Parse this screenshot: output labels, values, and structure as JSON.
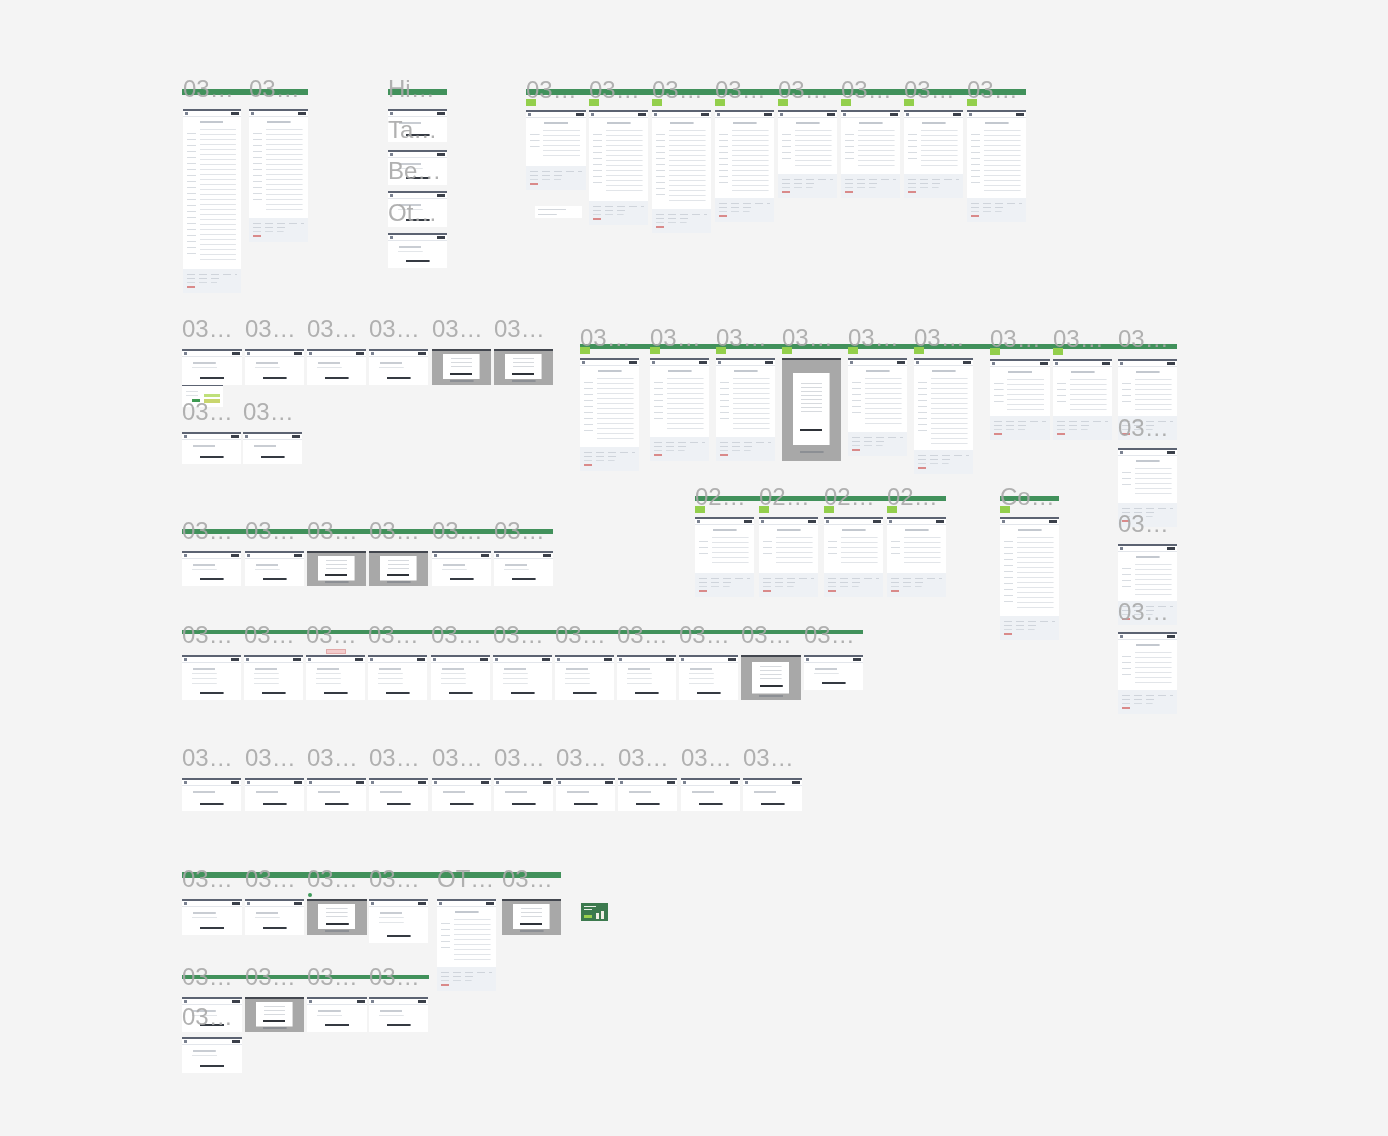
{
  "canvas": {
    "sections": [
      {
        "banner": true,
        "frames": [
          {
            "label": "03…",
            "kind": "site",
            "marked": false
          },
          {
            "label": "03…",
            "kind": "site",
            "marked": false
          }
        ]
      },
      {
        "banner": true,
        "frames": [
          {
            "label": "Hi…",
            "kind": "screen",
            "marked": false
          },
          {
            "label": "Ta…",
            "kind": "screen",
            "marked": false
          },
          {
            "label": "Be…",
            "kind": "screen",
            "marked": false
          },
          {
            "label": "Ot…",
            "kind": "screen",
            "marked": false
          }
        ]
      },
      {
        "banner": true,
        "frames": [
          {
            "label": "03…",
            "kind": "site",
            "marked": true
          },
          {
            "label": "03…",
            "kind": "site",
            "marked": true
          },
          {
            "label": "03…",
            "kind": "site",
            "marked": true
          },
          {
            "label": "03…",
            "kind": "site",
            "marked": true
          },
          {
            "label": "03…",
            "kind": "site",
            "marked": true
          },
          {
            "label": "03…",
            "kind": "site",
            "marked": true
          },
          {
            "label": "03…",
            "kind": "site",
            "marked": true
          },
          {
            "label": "03…",
            "kind": "site",
            "marked": true
          }
        ]
      },
      {
        "frames": [
          {
            "label": "03…",
            "kind": "screen",
            "marked": false
          },
          {
            "label": "03…",
            "kind": "screen",
            "marked": false
          },
          {
            "label": "03…",
            "kind": "screen",
            "marked": false
          },
          {
            "label": "03…",
            "kind": "screen",
            "marked": false
          },
          {
            "label": "03…",
            "kind": "modal",
            "marked": false
          },
          {
            "label": "03…",
            "kind": "modal",
            "marked": false
          },
          {
            "label": "03…",
            "kind": "screen",
            "marked": false
          },
          {
            "label": "03…",
            "kind": "screen",
            "marked": false
          }
        ]
      },
      {
        "banner": true,
        "frames": [
          {
            "label": "03…",
            "kind": "site",
            "marked": true
          },
          {
            "label": "03…",
            "kind": "site",
            "marked": true
          },
          {
            "label": "03…",
            "kind": "site",
            "marked": true
          },
          {
            "label": "03…",
            "kind": "modal",
            "marked": true
          },
          {
            "label": "03…",
            "kind": "site",
            "marked": true
          },
          {
            "label": "03…",
            "kind": "site",
            "marked": true
          },
          {
            "label": "03…",
            "kind": "site",
            "marked": true
          },
          {
            "label": "03…",
            "kind": "site",
            "marked": true
          },
          {
            "label": "03…",
            "kind": "site",
            "marked": false
          },
          {
            "label": "03…",
            "kind": "site",
            "marked": false
          },
          {
            "label": "03…",
            "kind": "site",
            "marked": false
          },
          {
            "label": "03…",
            "kind": "site",
            "marked": false
          }
        ]
      },
      {
        "banner": true,
        "frames": [
          {
            "label": "02…",
            "kind": "site",
            "marked": true
          },
          {
            "label": "02…",
            "kind": "site",
            "marked": true
          },
          {
            "label": "02…",
            "kind": "site",
            "marked": true
          },
          {
            "label": "02…",
            "kind": "site",
            "marked": true
          }
        ]
      },
      {
        "banner": true,
        "frames": [
          {
            "label": "Co…",
            "kind": "site",
            "marked": true
          }
        ]
      },
      {
        "banner": true,
        "frames": [
          {
            "label": "03…",
            "kind": "screen",
            "marked": false
          },
          {
            "label": "03…",
            "kind": "screen",
            "marked": false
          },
          {
            "label": "03…",
            "kind": "modal",
            "marked": false
          },
          {
            "label": "03…",
            "kind": "modal",
            "marked": false
          },
          {
            "label": "03…",
            "kind": "screen",
            "marked": false
          },
          {
            "label": "03…",
            "kind": "screen",
            "marked": false
          }
        ]
      },
      {
        "banner": true,
        "frames": [
          {
            "label": "03…",
            "kind": "screen",
            "marked": false
          },
          {
            "label": "03…",
            "kind": "screen",
            "marked": false
          },
          {
            "label": "03…",
            "kind": "screen",
            "marked": false
          },
          {
            "label": "03…",
            "kind": "screen",
            "marked": false
          },
          {
            "label": "03…",
            "kind": "screen",
            "marked": false
          },
          {
            "label": "03…",
            "kind": "screen",
            "marked": false
          },
          {
            "label": "03…",
            "kind": "screen",
            "marked": false
          },
          {
            "label": "03…",
            "kind": "screen",
            "marked": false
          },
          {
            "label": "03…",
            "kind": "screen",
            "marked": false
          },
          {
            "label": "03…",
            "kind": "modal",
            "marked": false
          },
          {
            "label": "03…",
            "kind": "screen",
            "marked": false
          }
        ]
      },
      {
        "frames": [
          {
            "label": "03…",
            "kind": "screen",
            "marked": false
          },
          {
            "label": "03…",
            "kind": "screen",
            "marked": false
          },
          {
            "label": "03…",
            "kind": "screen",
            "marked": false
          },
          {
            "label": "03…",
            "kind": "screen",
            "marked": false
          },
          {
            "label": "03…",
            "kind": "screen",
            "marked": false
          },
          {
            "label": "03…",
            "kind": "screen",
            "marked": false
          },
          {
            "label": "03…",
            "kind": "screen",
            "marked": false
          },
          {
            "label": "03…",
            "kind": "screen",
            "marked": false
          },
          {
            "label": "03…",
            "kind": "screen",
            "marked": false
          },
          {
            "label": "03…",
            "kind": "screen",
            "marked": false
          }
        ]
      },
      {
        "banner": true,
        "frames": [
          {
            "label": "03…",
            "kind": "screen",
            "marked": false
          },
          {
            "label": "03…",
            "kind": "screen",
            "marked": false
          },
          {
            "label": "03…",
            "kind": "modal",
            "marked": false
          },
          {
            "label": "03…",
            "kind": "screen",
            "marked": false
          },
          {
            "label": "OT…",
            "kind": "site",
            "marked": false
          },
          {
            "label": "03…",
            "kind": "modal",
            "marked": false
          }
        ]
      },
      {
        "banner": true,
        "frames": [
          {
            "label": "03…",
            "kind": "screen",
            "marked": false
          },
          {
            "label": "03…",
            "kind": "modal",
            "marked": false
          },
          {
            "label": "03…",
            "kind": "screen",
            "marked": false
          },
          {
            "label": "03…",
            "kind": "screen",
            "marked": false
          },
          {
            "label": "03…",
            "kind": "screen",
            "marked": false
          }
        ]
      }
    ]
  }
}
